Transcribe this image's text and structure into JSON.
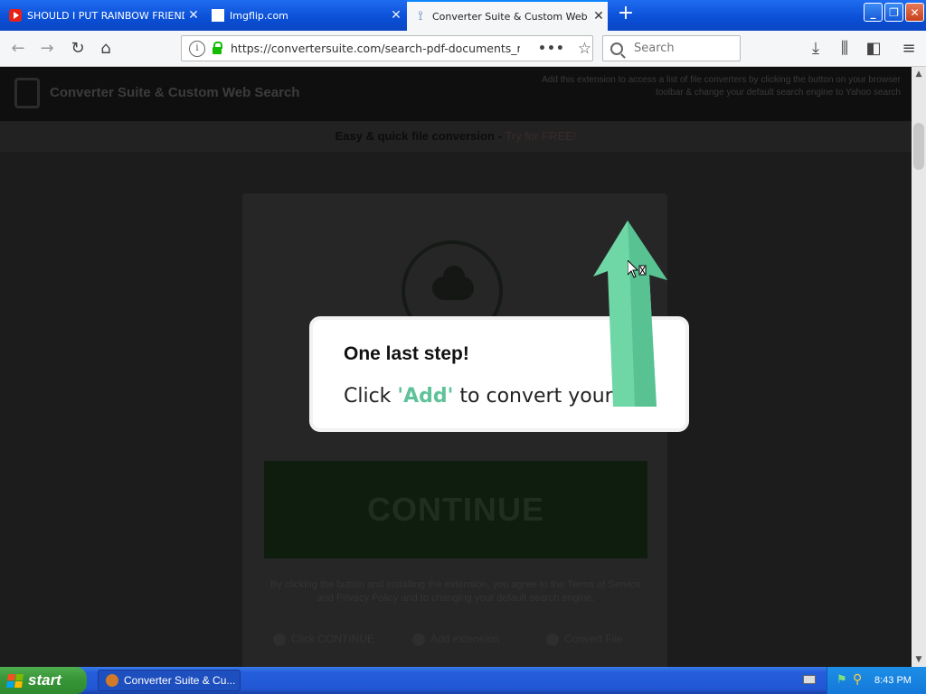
{
  "browser": {
    "tabs": [
      {
        "label": "SHOULD I PUT RAINBOW FRIENDS",
        "favicon": "youtube-icon",
        "active": false
      },
      {
        "label": "Imgflip.com",
        "favicon": "blank-page-icon",
        "active": false
      },
      {
        "label": "Converter Suite & Custom Web Se",
        "favicon": "converter-suite-icon",
        "active": true
      }
    ],
    "url": "https://convertersuite.com/search-pdf-documents_mjs",
    "search_placeholder": "Search"
  },
  "page": {
    "site_title": "Converter Suite & Custom Web Search",
    "notice": "Add this extension to access a list of file converters by clicking the button on your browser toolbar & change your default search engine to Yahoo search",
    "promo": "Easy & quick file conversion - ",
    "promo_link": "Try for FREE!",
    "continue_label": "CONTINUE",
    "fineprint": "By clicking the button and installing the extension, you agree to the Terms of Service and Privacy Policy and to changing your default search engine.",
    "steps": [
      {
        "label": "Click CONTINUE"
      },
      {
        "label": "Add extension"
      },
      {
        "label": "Convert File"
      }
    ],
    "popup": {
      "title": "One last step!",
      "text_prefix": "Click ",
      "text_add": "'Add'",
      "text_suffix": " to convert your file"
    }
  },
  "taskbar": {
    "start_label": "start",
    "task_item": "Converter Suite & Cu...",
    "clock": "8:43 PM"
  },
  "colors": {
    "accent_green": "#5fc29a",
    "titlebar_blue": "#0a4fd6",
    "start_green": "#3a963a"
  }
}
